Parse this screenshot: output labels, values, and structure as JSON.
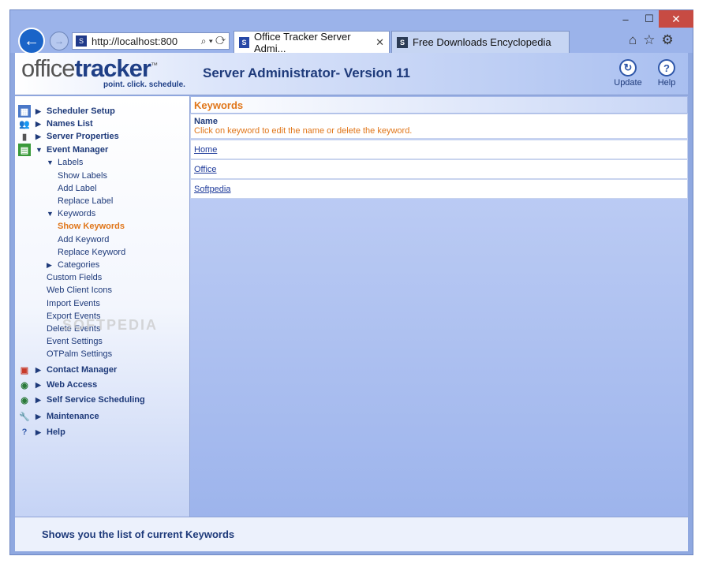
{
  "browser": {
    "url": "http://localhost:800",
    "tabs": [
      {
        "label": "Office Tracker Server Admi...",
        "active": true
      },
      {
        "label": "Free Downloads Encyclopedia",
        "active": false
      }
    ],
    "window_controls": {
      "minimize": "–",
      "maximize": "☐",
      "close": "✕"
    }
  },
  "header": {
    "logo_office": "office",
    "logo_tracker": "tracker",
    "logo_tm": "™",
    "logo_tagline": "point. click. schedule.",
    "title": "Server Administrator- Version 11",
    "update_label": "Update",
    "help_label": "Help"
  },
  "sidebar": {
    "scheduler_setup": "Scheduler Setup",
    "names_list": "Names List",
    "server_properties": "Server Properties",
    "event_manager": "Event Manager",
    "labels": "Labels",
    "show_labels": "Show Labels",
    "add_label": "Add Label",
    "replace_label": "Replace Label",
    "keywords": "Keywords",
    "show_keywords": "Show Keywords",
    "add_keyword": "Add Keyword",
    "replace_keyword": "Replace Keyword",
    "categories": "Categories",
    "custom_fields": "Custom Fields",
    "web_client_icons": "Web Client Icons",
    "import_events": "Import Events",
    "export_events": "Export Events",
    "delete_events": "Delete Events",
    "event_settings": "Event Settings",
    "otpalm_settings": "OTPalm Settings",
    "contact_manager": "Contact Manager",
    "web_access": "Web Access",
    "self_service": "Self Service Scheduling",
    "maintenance": "Maintenance",
    "help": "Help"
  },
  "main": {
    "panel_title": "Keywords",
    "col_name": "Name",
    "col_desc": "Click on keyword to edit the name or delete the keyword.",
    "keywords": [
      "Home",
      "Office",
      "Softpedia"
    ]
  },
  "footer": {
    "status": "Shows you the list of current Keywords"
  },
  "watermark": "SOFTPEDIA"
}
